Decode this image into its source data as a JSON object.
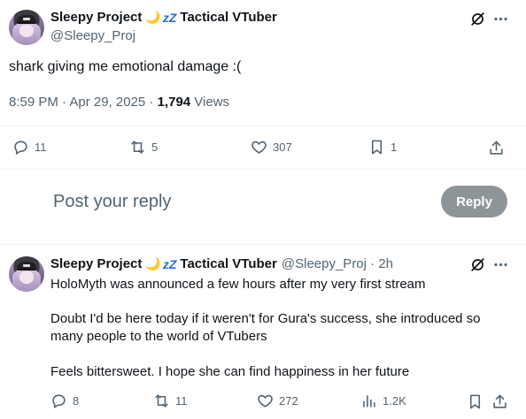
{
  "main_tweet": {
    "display_name": "Sleepy Project",
    "emoji_moon": "🌙",
    "emoji_zz": "zZ",
    "display_suffix": "Tactical VTuber",
    "handle": "@Sleepy_Proj",
    "text": "shark giving me emotional damage :(",
    "timestamp": "8:59 PM · Apr 29, 2025 · ",
    "views_count": "1,794",
    "views_label": " Views",
    "actions": {
      "replies": "11",
      "retweets": "5",
      "likes": "307",
      "bookmarks": "1"
    }
  },
  "reply_box": {
    "placeholder": "Post your reply",
    "button_label": "Reply"
  },
  "reply_tweet": {
    "display_name": "Sleepy Project",
    "emoji_moon": "🌙",
    "emoji_zz": "zZ",
    "display_suffix": "Tactical VTuber",
    "handle_time": "@Sleepy_Proj · 2h",
    "paragraphs": [
      "HoloMyth was announced a few hours after my very first stream",
      "Doubt I'd be here today if it weren't for Gura's success, she introduced so many people to the world of VTubers",
      "Feels bittersweet. I hope she can find happiness in her future"
    ],
    "actions": {
      "replies": "8",
      "retweets": "11",
      "likes": "272",
      "views": "1.2K"
    }
  },
  "colors": {
    "text_primary": "#0f1419",
    "text_secondary": "#536471",
    "divider": "#eff3f4",
    "reply_button_bg": "#8e9599",
    "zz_blue": "#1d6fd8"
  },
  "icons": [
    "grok-icon",
    "more-icon",
    "reply-icon",
    "retweet-icon",
    "like-icon",
    "bookmark-icon",
    "share-icon",
    "views-icon"
  ]
}
